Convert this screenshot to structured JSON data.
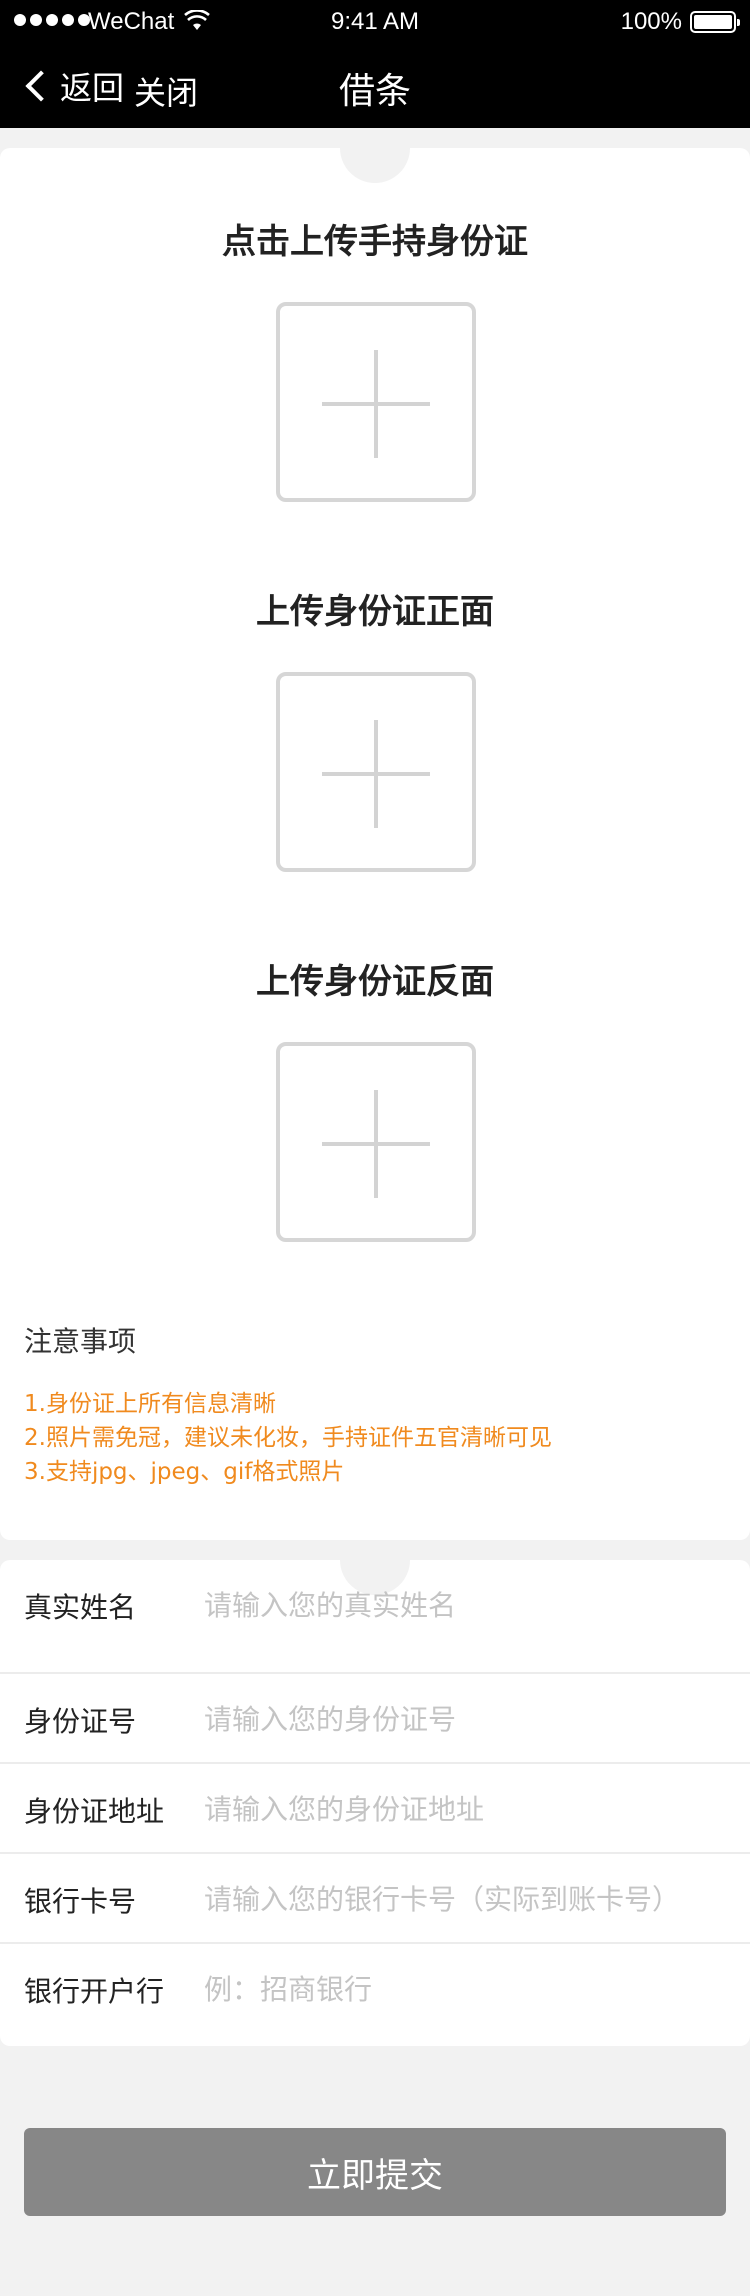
{
  "status_bar": {
    "carrier": "WeChat",
    "time": "9:41 AM",
    "battery": "100%"
  },
  "nav": {
    "back_label": "返回",
    "close_label": "关闭",
    "title": "借条"
  },
  "uploads": [
    {
      "title": "点击上传手持身份证"
    },
    {
      "title": "上传身份证正面"
    },
    {
      "title": "上传身份证反面"
    }
  ],
  "notes": {
    "title": "注意事项",
    "lines": [
      "1.身份证上所有信息清晰",
      "2.照片需免冠，建议未化妆，手持证件五官清晰可见",
      "3.支持jpg、jpeg、gif格式照片"
    ],
    "color": "#f08a1e"
  },
  "form": {
    "fields": [
      {
        "label": "真实姓名",
        "placeholder": "请输入您的真实姓名"
      },
      {
        "label": "身份证号",
        "placeholder": "请输入您的身份证号"
      },
      {
        "label": "身份证地址",
        "placeholder": "请输入您的身份证地址"
      },
      {
        "label": "银行卡号",
        "placeholder": "请输入您的银行卡号（实际到账卡号）"
      },
      {
        "label": "银行开户行",
        "placeholder": "例：招商银行"
      }
    ]
  },
  "submit": {
    "label": "立即提交"
  }
}
